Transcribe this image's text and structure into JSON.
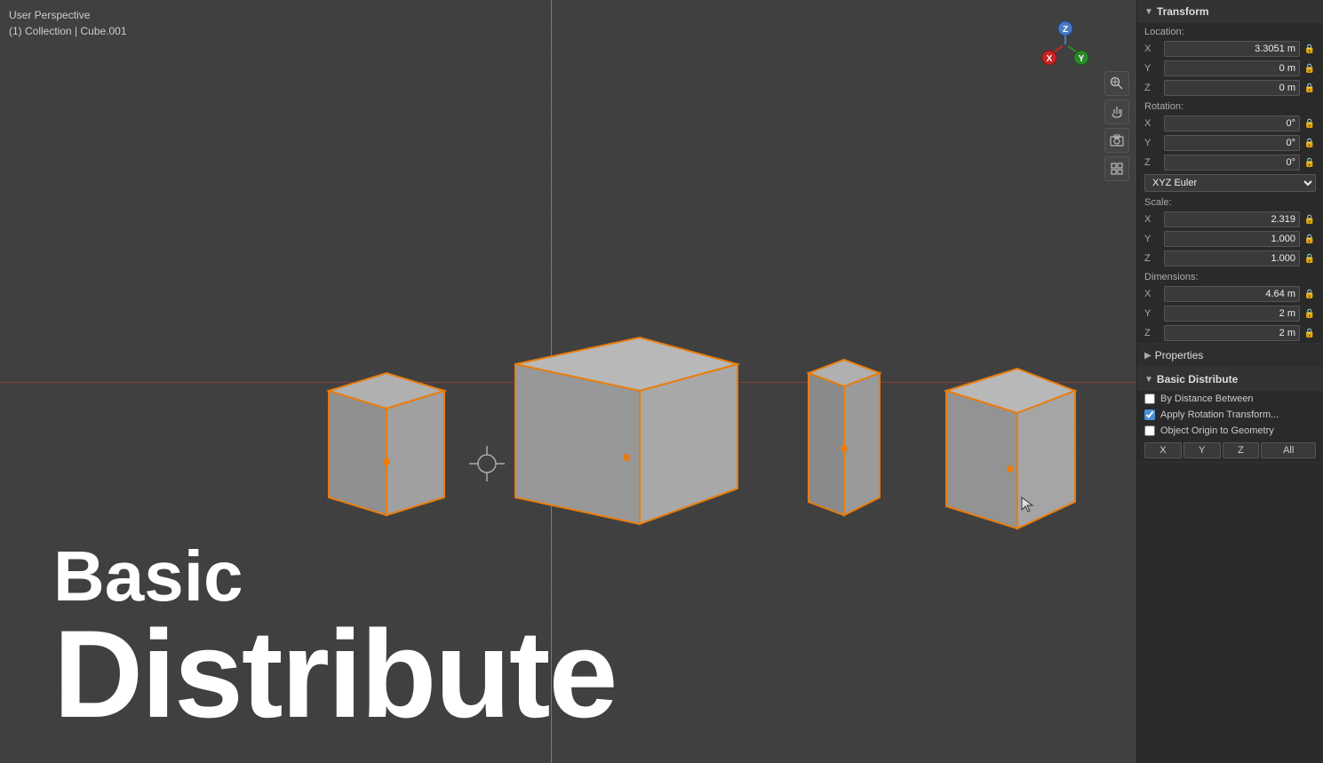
{
  "viewport": {
    "perspective_label": "User Perspective",
    "collection_label": "(1) Collection | Cube.001",
    "axis_lines": {
      "vertical_color": "rgba(100,180,100,0.7)",
      "horizontal_color": "rgba(210,60,60,0.5)"
    }
  },
  "title": {
    "line1": "Basic",
    "line2": "Distribute"
  },
  "nav_icons": [
    {
      "name": "zoom-icon",
      "symbol": "🔍"
    },
    {
      "name": "hand-icon",
      "symbol": "✋"
    },
    {
      "name": "camera-icon",
      "symbol": "📷"
    },
    {
      "name": "grid-icon",
      "symbol": "⊞"
    }
  ],
  "panel": {
    "transform_header": "Transform",
    "location_label": "Location:",
    "location": {
      "x": "3.3051 m",
      "y": "0 m",
      "z": "0 m"
    },
    "rotation_label": "Rotation:",
    "rotation": {
      "x": "0°",
      "y": "0°",
      "z": "0°"
    },
    "euler_mode": "XYZ Euler",
    "scale_label": "Scale:",
    "scale": {
      "x": "2.319",
      "y": "1.000",
      "z": "1.000"
    },
    "dimensions_label": "Dimensions:",
    "dimensions": {
      "x": "4.64 m",
      "y": "2 m",
      "z": "2 m"
    },
    "properties_label": "Properties",
    "basic_distribute_label": "Basic Distribute",
    "checkboxes": [
      {
        "id": "cb1",
        "label": "By Distance Between",
        "checked": false
      },
      {
        "id": "cb2",
        "label": "Apply Rotation Transform...",
        "checked": true
      },
      {
        "id": "cb3",
        "label": "Object Origin to Geometry",
        "checked": false
      }
    ],
    "xyz_buttons": [
      "X",
      "Y",
      "Z",
      "All"
    ],
    "lock_symbol": "🔒"
  },
  "colors": {
    "selected_orange": "#e87d0d",
    "panel_bg": "#2a2a2a",
    "viewport_bg": "#404040",
    "grid_line": "#4a4a4a",
    "axis_x_color": "#1e90ff",
    "axis_y_color": "#3cb371",
    "axis_z_color": "#dc143c"
  }
}
